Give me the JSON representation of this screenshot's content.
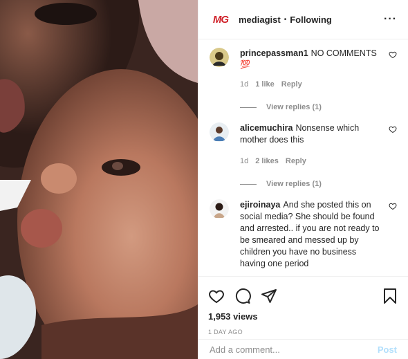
{
  "post": {
    "username": "mediagist",
    "logo_text": "MG",
    "separator": "•",
    "follow_status": "Following",
    "more_icon": "more-horizontal-icon",
    "more_label": "···"
  },
  "comments": [
    {
      "username": "princepassman1",
      "text": "NO COMMENTS",
      "emoji": "💯",
      "time": "1d",
      "likes": "1 like",
      "reply_label": "Reply",
      "view_replies": "View replies (1)"
    },
    {
      "username": "alicemuchira",
      "text": "Nonsense which mother does this",
      "time": "1d",
      "likes": "2 likes",
      "reply_label": "Reply",
      "view_replies": "View replies (1)"
    },
    {
      "username": "ejiroinaya",
      "text": "And she posted this on social media? She should be found and arrested.. if you are not ready to be smeared and messed up by children you have no business having one period"
    }
  ],
  "actions": {
    "icons": [
      "heart-icon",
      "comment-icon",
      "share-icon",
      "bookmark-icon"
    ],
    "views": "1,953 views",
    "date": "1 DAY AGO"
  },
  "composer": {
    "placeholder": "Add a comment...",
    "post_label": "Post"
  },
  "colors": {
    "brand_red": "#d0222a",
    "muted": "#8e8e8e",
    "post_disabled": "#b2dffc",
    "emoji_red": "#e0245e"
  }
}
